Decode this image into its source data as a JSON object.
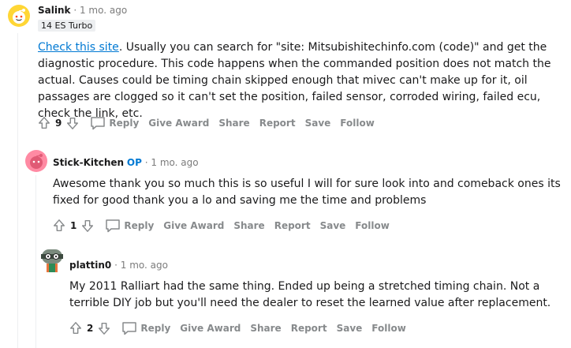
{
  "comments": [
    {
      "username": "Salink",
      "timestamp": "1 mo. ago",
      "flair": "14 ES Turbo",
      "link_text": "Check this site",
      "body_rest": ". Usually you can search for \"site: Mitsubishitechinfo.com (code)\" and get the diagnostic procedure. This code happens when the commanded position does not match the actual. Causes could be timing chain skipped enough that mivec can't make up for it, oil passages are clogged so it can't set the position, failed sensor, corroded wiring, failed ecu, check the link, etc.",
      "score": "9",
      "actions": {
        "reply": "Reply",
        "give_award": "Give Award",
        "share": "Share",
        "report": "Report",
        "save": "Save",
        "follow": "Follow"
      }
    },
    {
      "username": "Stick-Kitchen",
      "op_badge": "OP",
      "timestamp": "1 mo. ago",
      "body": "Awesome thank you so much this is so useful I will for sure look into and comeback ones its fixed for good thank you a lo and saving me the time and problems",
      "score": "1",
      "actions": {
        "reply": "Reply",
        "give_award": "Give Award",
        "share": "Share",
        "report": "Report",
        "save": "Save",
        "follow": "Follow"
      }
    },
    {
      "username": "plattin0",
      "timestamp": "1 mo. ago",
      "body": "My 2011 Ralliart had the same thing. Ended up being a stretched timing chain. Not a terrible DIY job but you'll need the dealer to reset the learned value after replacement.",
      "score": "2",
      "actions": {
        "reply": "Reply",
        "give_award": "Give Award",
        "share": "Share",
        "report": "Report",
        "save": "Save",
        "follow": "Follow"
      }
    }
  ],
  "separator": "·",
  "colors": {
    "accent_link": "#0079d3",
    "muted": "#878a8c",
    "thread_line": "#edeff1"
  },
  "icons": [
    "upvote-icon",
    "downvote-icon",
    "reply-icon",
    "avatar-icon"
  ]
}
